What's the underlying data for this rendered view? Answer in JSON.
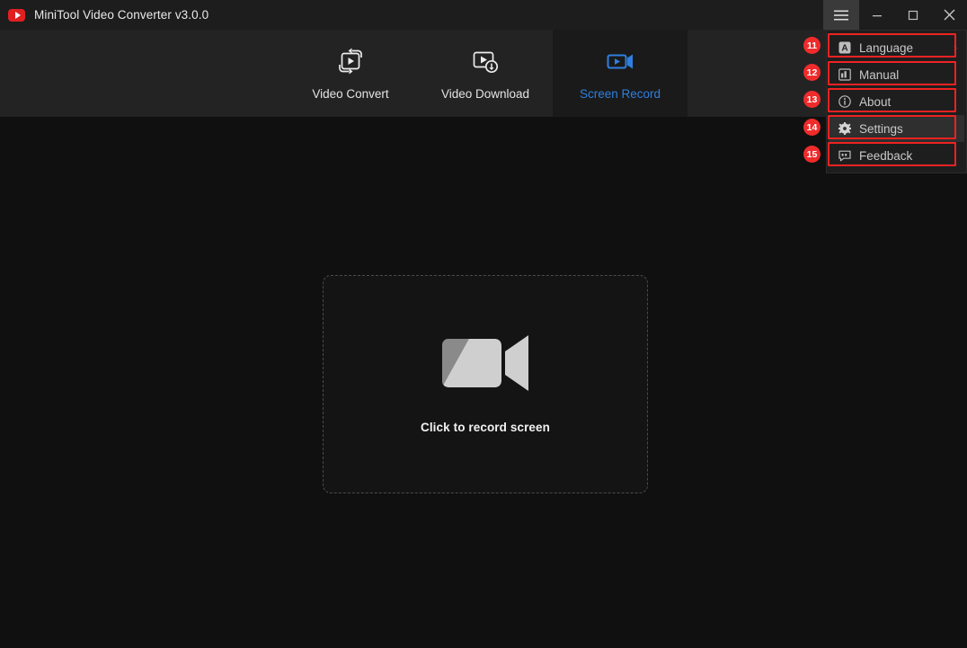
{
  "window": {
    "title": "MiniTool Video Converter v3.0.0",
    "logo_icon": "minitool-play-logo",
    "controls": {
      "menu": {
        "label": "",
        "icon": "hamburger-menu-icon"
      },
      "minimize": {
        "label": "",
        "icon": "minimize-icon"
      },
      "maximize": {
        "label": "",
        "icon": "maximize-icon"
      },
      "close": {
        "label": "",
        "icon": "close-icon"
      }
    }
  },
  "nav": {
    "tabs": [
      {
        "label": "Video Convert",
        "icon": "video-convert-icon",
        "active": false
      },
      {
        "label": "Video Download",
        "icon": "video-download-icon",
        "active": false
      },
      {
        "label": "Screen Record",
        "icon": "screen-record-icon",
        "active": true
      }
    ],
    "active_index": 2
  },
  "main": {
    "dropzone": {
      "caption": "Click to record screen",
      "icon": "camcorder-icon"
    }
  },
  "menu": {
    "items": [
      {
        "label": "Language",
        "icon": "language-a-icon",
        "chevron": "›",
        "badge": "11",
        "highlighted": false
      },
      {
        "label": "Manual",
        "icon": "manual-book-icon",
        "chevron": "",
        "badge": "12",
        "highlighted": false
      },
      {
        "label": "About",
        "icon": "info-circle-icon",
        "chevron": "",
        "badge": "13",
        "highlighted": false
      },
      {
        "label": "Settings",
        "icon": "gear-icon",
        "chevron": "",
        "badge": "14",
        "highlighted": true
      },
      {
        "label": "Feedback",
        "icon": "feedback-bubble-icon",
        "chevron": "",
        "badge": "15",
        "highlighted": false
      }
    ]
  },
  "colors": {
    "accent_blue": "#2f7fe0",
    "annotation_red": "#ee2222",
    "badge_red": "#f02b2b",
    "logo_red": "#e02020",
    "titlebar_bg": "#1d1d1d",
    "navbar_bg": "#232323",
    "active_tab_bg": "#1a1a1a",
    "body_bg": "#101010",
    "menu_bg": "#1e1e1e"
  }
}
